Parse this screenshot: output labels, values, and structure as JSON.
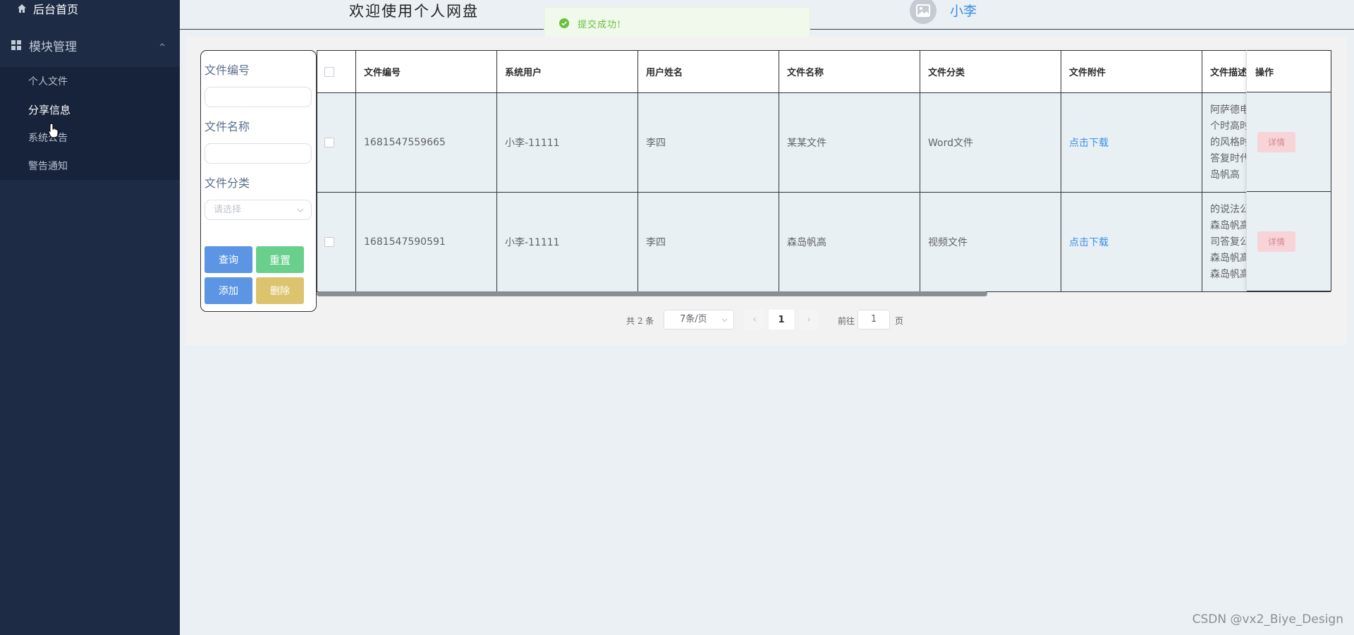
{
  "sidebar": {
    "home_label": "后台首页",
    "group_label": "模块管理",
    "items": [
      {
        "label": "个人文件"
      },
      {
        "label": "分享信息"
      },
      {
        "label": "系统公告"
      },
      {
        "label": "警告通知"
      }
    ]
  },
  "header": {
    "welcome": "欢迎使用个人网盘",
    "username": "小李"
  },
  "toast": {
    "message": "提交成功!"
  },
  "search": {
    "file_no_label": "文件编号",
    "file_no_value": "",
    "file_name_label": "文件名称",
    "file_name_value": "",
    "category_label": "文件分类",
    "category_placeholder": "请选择",
    "query_label": "查询",
    "reset_label": "重置",
    "add_label": "添加",
    "delete_label": "删除"
  },
  "table": {
    "columns": [
      "文件编号",
      "系统用户",
      "用户姓名",
      "文件名称",
      "文件分类",
      "文件附件",
      "文件描述"
    ],
    "op_header": "操作",
    "rows": [
      {
        "file_no": "1681547559665",
        "system_user": "小李-11111",
        "user_name": "李四",
        "file_name": "某某文件",
        "category": "Word文件",
        "attachment": "点击下载",
        "description": "阿萨德电\n个时高时\n的风格时\n答复时代\n岛帆高",
        "op": "详情"
      },
      {
        "file_no": "1681547590591",
        "system_user": "小李-11111",
        "user_name": "李四",
        "file_name": "森岛帆高",
        "category": "视频文件",
        "attachment": "点击下载",
        "description": "的说法公\n森岛帆高\n司答复公\n森岛帆高\n森岛帆高",
        "op": "详情"
      }
    ]
  },
  "pagination": {
    "total_text": "共 2 条",
    "page_size": "7条/页",
    "prev": "‹",
    "current_page": "1",
    "next": "›",
    "goto_label": "前往",
    "goto_value": "1",
    "goto_suffix": "页"
  },
  "watermark": "CSDN @vx2_Biye_Design",
  "colors": {
    "sidebar_bg": "#1d2b45",
    "primary": "#5c95e3",
    "success": "#69cf8d",
    "warning": "#dcc46f",
    "danger_light": "#f6d4d8",
    "link": "#3a8ee6"
  }
}
